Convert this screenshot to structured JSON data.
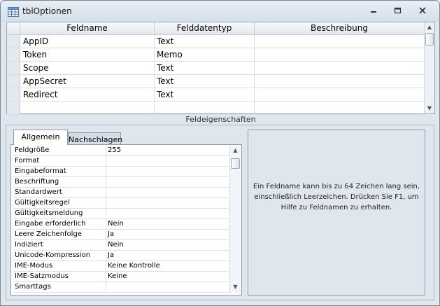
{
  "window": {
    "title": "tblOptionen",
    "icon": "table-icon",
    "minimize_icon": "minimize-icon",
    "maximize_icon": "restore-icon",
    "close_icon": "close-icon"
  },
  "grid": {
    "headers": {
      "name": "Feldname",
      "type": "Felddatentyp",
      "description": "Beschreibung"
    },
    "rows": [
      {
        "name": "AppID",
        "type": "Text",
        "description": ""
      },
      {
        "name": "Token",
        "type": "Memo",
        "description": ""
      },
      {
        "name": "Scope",
        "type": "Text",
        "description": ""
      },
      {
        "name": "AppSecret",
        "type": "Text",
        "description": ""
      },
      {
        "name": "Redirect",
        "type": "Text",
        "description": ""
      },
      {
        "name": "",
        "type": "",
        "description": ""
      }
    ]
  },
  "field_properties_label": "Feldeigenschaften",
  "tabs": {
    "general": "Allgemein",
    "lookup": "Nachschlagen"
  },
  "properties": [
    {
      "label": "Feldgröße",
      "value": "255"
    },
    {
      "label": "Format",
      "value": ""
    },
    {
      "label": "Eingabeformat",
      "value": ""
    },
    {
      "label": "Beschriftung",
      "value": ""
    },
    {
      "label": "Standardwert",
      "value": ""
    },
    {
      "label": "Gültigkeitsregel",
      "value": ""
    },
    {
      "label": "Gültigkeitsmeldung",
      "value": ""
    },
    {
      "label": "Eingabe erforderlich",
      "value": "Nein"
    },
    {
      "label": "Leere Zeichenfolge",
      "value": "Ja"
    },
    {
      "label": "Indiziert",
      "value": "Nein"
    },
    {
      "label": "Unicode-Kompression",
      "value": "Ja"
    },
    {
      "label": "IME-Modus",
      "value": "Keine Kontrolle"
    },
    {
      "label": "IME-Satzmodus",
      "value": "Keine"
    },
    {
      "label": "Smarttags",
      "value": ""
    }
  ],
  "help_text": "Ein Feldname kann bis zu 64 Zeichen lang sein, einschließlich Leerzeichen. Drücken Sie F1, um Hilfe zu Feldnamen zu erhalten."
}
